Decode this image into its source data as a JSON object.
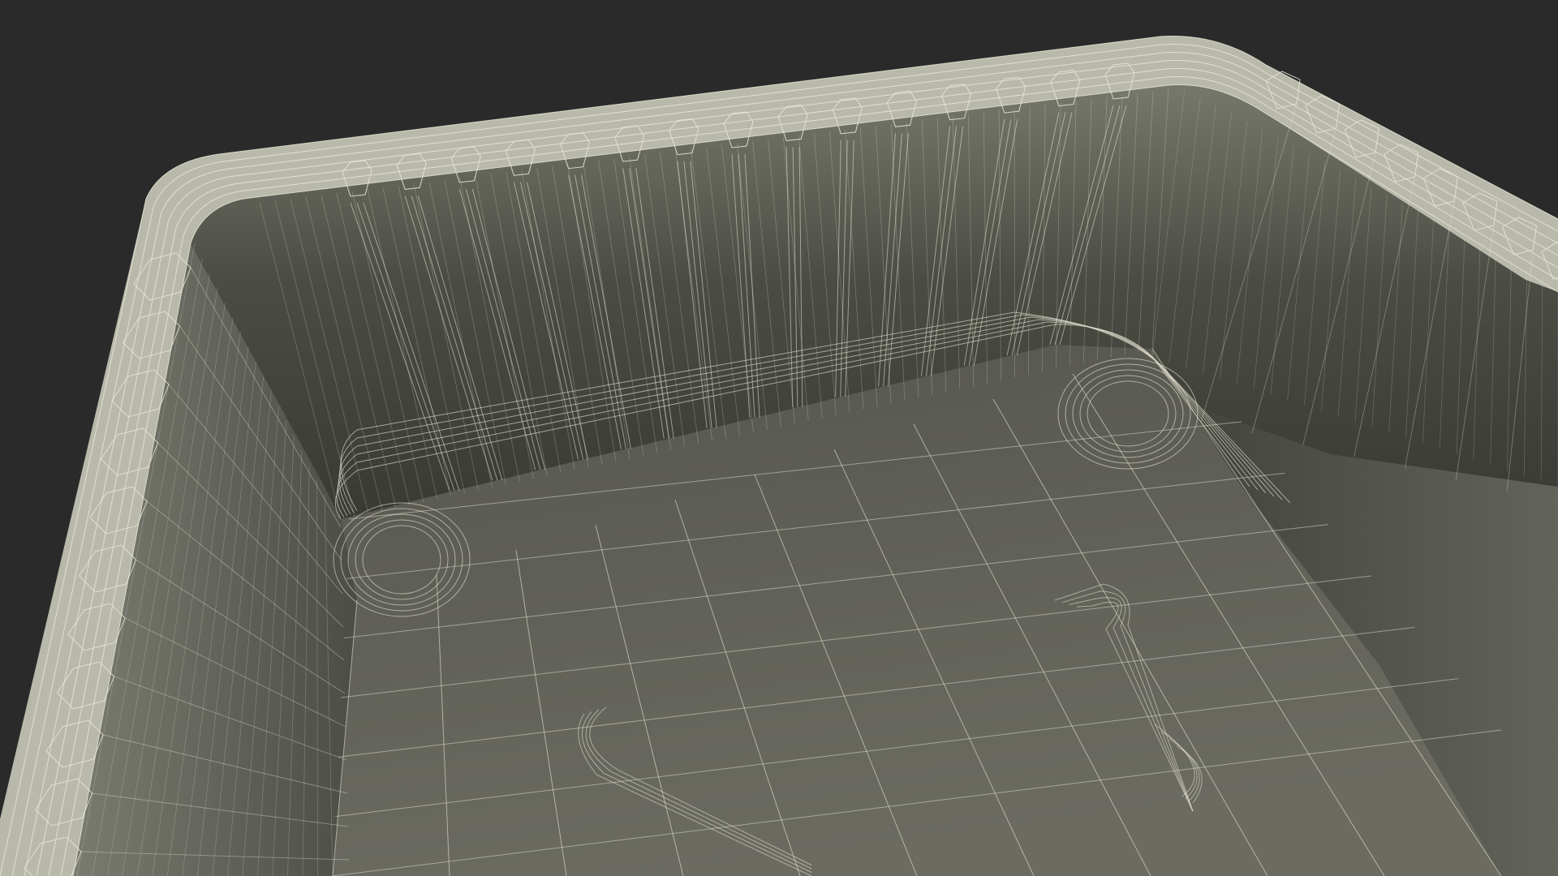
{
  "scene": {
    "background_color": "#2a2a2a",
    "wire_color": "#e7e6d6",
    "rim_color": "#bcbcae",
    "wall_light_color": "#707065",
    "wall_dark_color": "#3a3b35",
    "floor_color": "#5d5d55"
  }
}
